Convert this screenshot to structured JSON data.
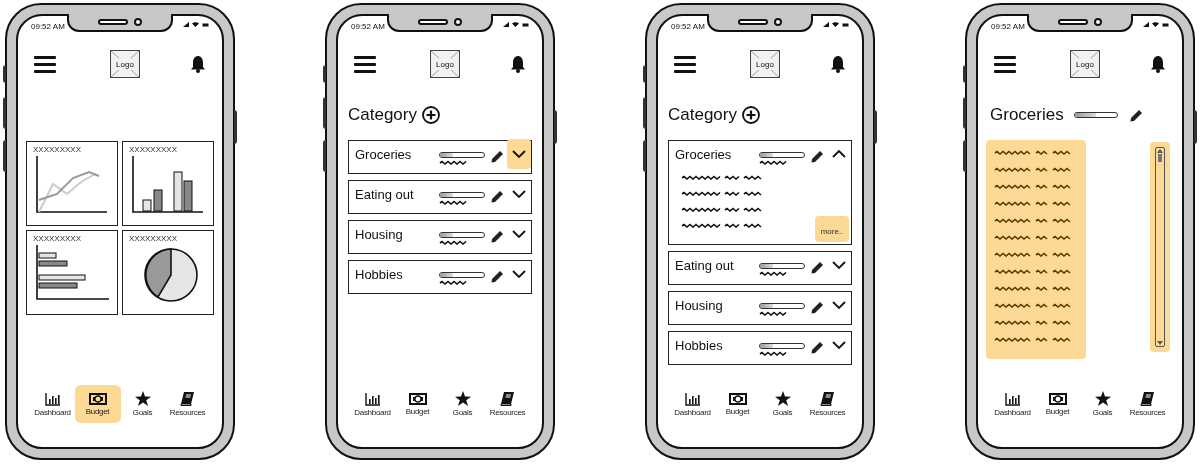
{
  "phones": [
    {
      "kind": "dashboard",
      "status_time": "09:52 AM",
      "logo": "Logo",
      "charts": [
        {
          "kind": "line",
          "title": "XXXXXXXXX"
        },
        {
          "kind": "bar",
          "title": "XXXXXXXXX"
        },
        {
          "kind": "hbar",
          "title": "XXXXXXXXX"
        },
        {
          "kind": "pie",
          "title": "XXXXXXXXX"
        }
      ],
      "nav": [
        {
          "kind": "chart",
          "label": "Dashboard",
          "highlighted": false
        },
        {
          "kind": "money",
          "label": "Budget",
          "highlighted": true
        },
        {
          "kind": "star",
          "label": "Goals",
          "highlighted": false
        },
        {
          "kind": "book",
          "label": "Resources",
          "highlighted": false
        }
      ]
    },
    {
      "kind": "categories",
      "status_time": "09:52 AM",
      "logo": "Logo",
      "heading": "Category",
      "categories": [
        {
          "name": "Groceries",
          "level": 0.3,
          "expanded": false,
          "highlighted": true
        },
        {
          "name": "Eating out",
          "level": 0.3,
          "expanded": false,
          "highlighted": false
        },
        {
          "name": "Housing",
          "level": 0.3,
          "expanded": false,
          "highlighted": false
        },
        {
          "name": "Hobbies",
          "level": 0.3,
          "expanded": false,
          "highlighted": false
        }
      ],
      "nav": [
        {
          "kind": "chart",
          "label": "Dashboard",
          "highlighted": false
        },
        {
          "kind": "money",
          "label": "Budget",
          "highlighted": false
        },
        {
          "kind": "star",
          "label": "Goals",
          "highlighted": false
        },
        {
          "kind": "book",
          "label": "Resources",
          "highlighted": false
        }
      ]
    },
    {
      "kind": "categories",
      "status_time": "09:52 AM",
      "logo": "Logo",
      "heading": "Category",
      "more": {
        "label": "more..",
        "highlighted": true
      },
      "categories": [
        {
          "name": "Groceries",
          "level": 0.3,
          "expanded": true,
          "highlighted": false
        },
        {
          "name": "Eating out",
          "level": 0.3,
          "expanded": false,
          "highlighted": false
        },
        {
          "name": "Housing",
          "level": 0.3,
          "expanded": false,
          "highlighted": false
        },
        {
          "name": "Hobbies",
          "level": 0.3,
          "expanded": false,
          "highlighted": false
        }
      ],
      "nav": [
        {
          "kind": "chart",
          "label": "Dashboard",
          "highlighted": false
        },
        {
          "kind": "money",
          "label": "Budget",
          "highlighted": false
        },
        {
          "kind": "star",
          "label": "Goals",
          "highlighted": false
        },
        {
          "kind": "book",
          "label": "Resources",
          "highlighted": false
        }
      ]
    },
    {
      "kind": "detail",
      "status_time": "09:52 AM",
      "logo": "Logo",
      "heading": "Groceries",
      "level": 0.5,
      "list_highlighted": true,
      "scrollbar_highlighted": true,
      "nav": [
        {
          "kind": "chart",
          "label": "Dashboard",
          "highlighted": false
        },
        {
          "kind": "money",
          "label": "Budget",
          "highlighted": false
        },
        {
          "kind": "star",
          "label": "Goals",
          "highlighted": false
        },
        {
          "kind": "book",
          "label": "Resources",
          "highlighted": false
        }
      ]
    }
  ]
}
